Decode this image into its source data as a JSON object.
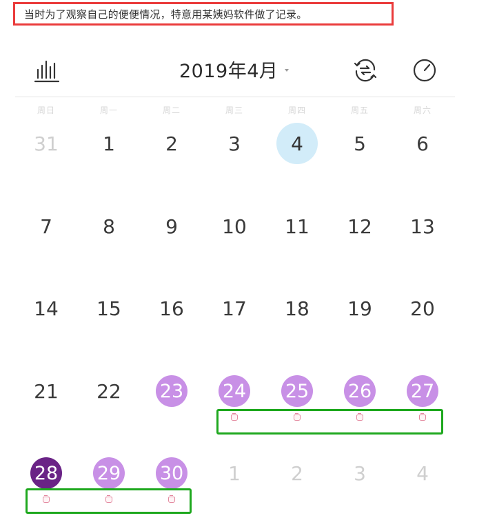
{
  "caption": {
    "text": "当时为了观察自己的便便情况，特意用某姨妈软件做了记录。"
  },
  "header": {
    "month_title": "2019年4月",
    "left_icon": "stats-bars-icon",
    "right_icons": [
      "sync-icon",
      "stopwatch-icon"
    ]
  },
  "weekdays": [
    "周日",
    "周一",
    "周二",
    "周三",
    "周四",
    "周五",
    "周六"
  ],
  "calendar": {
    "month": "2019-04",
    "weeks": [
      [
        {
          "label": "31",
          "state": "muted"
        },
        {
          "label": "1",
          "state": "normal"
        },
        {
          "label": "2",
          "state": "normal"
        },
        {
          "label": "3",
          "state": "normal"
        },
        {
          "label": "4",
          "state": "today"
        },
        {
          "label": "5",
          "state": "normal"
        },
        {
          "label": "6",
          "state": "normal"
        }
      ],
      [
        {
          "label": "7",
          "state": "normal"
        },
        {
          "label": "8",
          "state": "normal"
        },
        {
          "label": "9",
          "state": "normal"
        },
        {
          "label": "10",
          "state": "normal"
        },
        {
          "label": "11",
          "state": "normal"
        },
        {
          "label": "12",
          "state": "normal"
        },
        {
          "label": "13",
          "state": "normal"
        }
      ],
      [
        {
          "label": "14",
          "state": "normal"
        },
        {
          "label": "15",
          "state": "normal"
        },
        {
          "label": "16",
          "state": "normal"
        },
        {
          "label": "17",
          "state": "normal"
        },
        {
          "label": "18",
          "state": "normal"
        },
        {
          "label": "19",
          "state": "normal"
        },
        {
          "label": "20",
          "state": "normal"
        }
      ],
      [
        {
          "label": "21",
          "state": "normal"
        },
        {
          "label": "22",
          "state": "normal"
        },
        {
          "label": "23",
          "state": "period",
          "marker": false
        },
        {
          "label": "24",
          "state": "period",
          "marker": true
        },
        {
          "label": "25",
          "state": "period",
          "marker": true
        },
        {
          "label": "26",
          "state": "period",
          "marker": true
        },
        {
          "label": "27",
          "state": "period",
          "marker": true
        }
      ],
      [
        {
          "label": "28",
          "state": "period-dark",
          "marker": true
        },
        {
          "label": "29",
          "state": "period",
          "marker": true
        },
        {
          "label": "30",
          "state": "period",
          "marker": true
        },
        {
          "label": "1",
          "state": "muted"
        },
        {
          "label": "2",
          "state": "muted"
        },
        {
          "label": "3",
          "state": "muted"
        },
        {
          "label": "4",
          "state": "muted"
        }
      ]
    ]
  },
  "colors": {
    "today_bg": "#d2ecf9",
    "period": "#c890e6",
    "period_dark": "#6a2386",
    "marker": "#e48aa0",
    "annotation_red": "#ea3b3b",
    "annotation_green": "#1ea81e"
  }
}
